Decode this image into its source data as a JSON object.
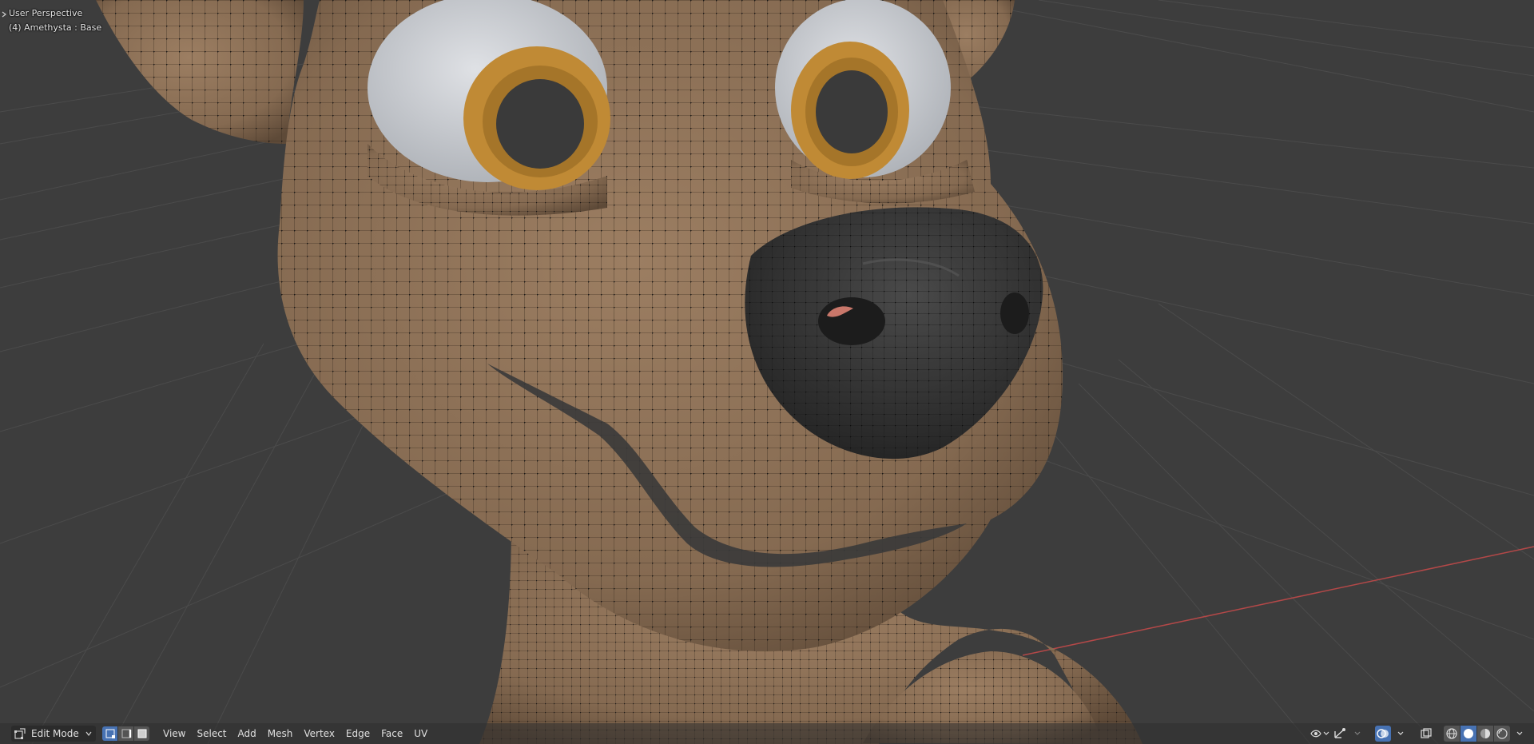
{
  "viewport": {
    "perspective_label": "User Perspective",
    "object_label": "(4) Amethysta : Base"
  },
  "header": {
    "mode": "Edit Mode",
    "select_modes": [
      "vertex-select-icon",
      "edge-select-icon",
      "face-select-icon"
    ],
    "active_select_mode": "vertex",
    "menus": [
      "View",
      "Select",
      "Add",
      "Mesh",
      "Vertex",
      "Edge",
      "Face",
      "UV"
    ],
    "right_icons": [
      "visibility-icon",
      "gizmo-icon",
      "overlay-icon",
      "xray-icon",
      "wireframe-shading-icon",
      "solid-shading-icon",
      "material-shading-icon",
      "rendered-shading-icon"
    ],
    "active_shading": "solid"
  },
  "colors": {
    "background": "#3d3d3d",
    "grid": "#4a4a4a",
    "x_axis": "#b34848",
    "skin": "#8a6f55",
    "nose": "#2f2f2f",
    "iris": "#c08a35",
    "eye_white": "#c9ccd1",
    "pupil": "#3a3a3a",
    "active_button": "#4772b3"
  }
}
